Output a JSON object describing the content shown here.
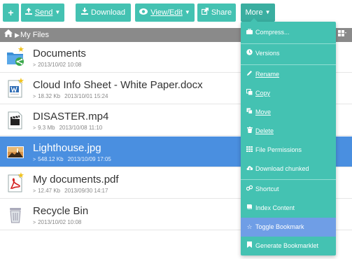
{
  "toolbar": {
    "add_label": "+",
    "send_label": "Send",
    "download_label": "Download",
    "view_label": "View/Edit",
    "share_label": "Share",
    "more_label": "More"
  },
  "path": {
    "label": "My Files"
  },
  "files": [
    {
      "name": "Documents",
      "size": "",
      "date": "2013/10/02 10:08",
      "type": "folder-shared",
      "bookmarked": true,
      "selected": false
    },
    {
      "name": "Cloud Info Sheet - White Paper.docx",
      "size": "18.32 Kb",
      "date": "2013/10/01 15:24",
      "type": "docx",
      "bookmarked": true,
      "selected": false
    },
    {
      "name": "DISASTER.mp4",
      "size": "9.3 Mb",
      "date": "2013/10/08 11:10",
      "type": "video",
      "bookmarked": false,
      "selected": false
    },
    {
      "name": "Lighthouse.jpg",
      "size": "548.12 Kb",
      "date": "2013/10/09 17:05",
      "type": "image",
      "bookmarked": false,
      "selected": true
    },
    {
      "name": "My documents.pdf",
      "size": "12.47 Kb",
      "date": "2013/09/30 14:17",
      "type": "pdf",
      "bookmarked": true,
      "selected": false
    },
    {
      "name": "Recycle Bin",
      "size": "",
      "date": "2013/10/02 10:08",
      "type": "trash",
      "bookmarked": false,
      "selected": false
    }
  ],
  "menu": {
    "items": [
      {
        "label": "Compress...",
        "icon": "briefcase-icon"
      },
      {
        "label": "Versions",
        "icon": "clock-icon"
      },
      {
        "label": "Rename",
        "icon": "pencil-icon"
      },
      {
        "label": "Copy",
        "icon": "copy-icon"
      },
      {
        "label": "Move",
        "icon": "move-icon"
      },
      {
        "label": "Delete",
        "icon": "trash-icon"
      },
      {
        "label": "File Permissions",
        "icon": "grid-icon"
      },
      {
        "label": "Download chunked",
        "icon": "cloud-download-icon"
      },
      {
        "label": "Shortcut",
        "icon": "link-icon"
      },
      {
        "label": "Index Content",
        "icon": "book-icon"
      },
      {
        "label": "Toggle Bookmark",
        "icon": "star-icon"
      },
      {
        "label": "Generate Bookmarklet",
        "icon": "bookmark-icon"
      }
    ]
  }
}
